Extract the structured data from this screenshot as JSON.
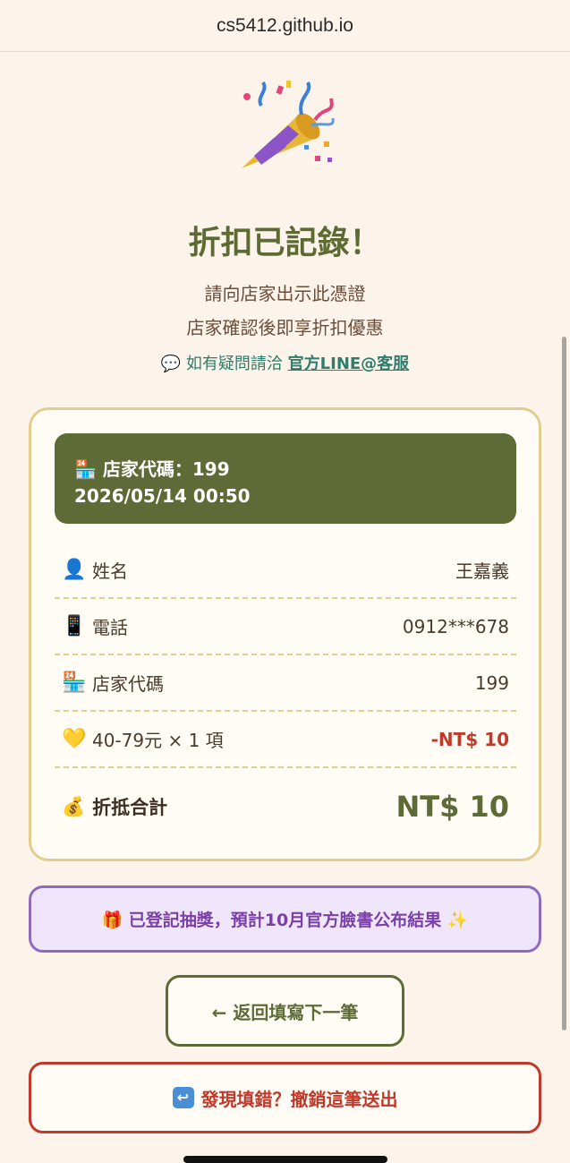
{
  "browser": {
    "url": "cs5412.github.io"
  },
  "header": {
    "icon": "party-popper-icon",
    "title": "折扣已記錄！",
    "subtitle_1": "請向店家出示此憑證",
    "subtitle_2": "店家確認後即享折扣優惠",
    "help_prefix": "💬 如有疑問請洽 ",
    "help_link": "官方LINE@客服"
  },
  "card": {
    "banner": {
      "icon": "convenience-store-icon",
      "store_code_line": "🏪 店家代碼：199",
      "datetime": "2026/05/14 00:50"
    },
    "rows": [
      {
        "icon": "👤",
        "label": "姓名",
        "value": "王嘉義"
      },
      {
        "icon": "📱",
        "label": "電話",
        "value": "0912***678"
      },
      {
        "icon": "🏪",
        "label": "店家代碼",
        "value": "199"
      },
      {
        "icon": "💛",
        "label": "40-79元 × 1 項",
        "value": "-NT$ 10"
      }
    ],
    "total": {
      "icon": "💰",
      "label": "折抵合計",
      "amount": "NT$ 10"
    }
  },
  "lottery": {
    "text": "🎁 已登記抽獎，預計10月官方臉書公布結果 ✨"
  },
  "buttons": {
    "back": "← 返回填寫下一筆",
    "undo_icon": "↩",
    "undo": "發現填錯？撤銷這筆送出"
  },
  "colors": {
    "background": "#fcf4ea",
    "accent_green": "#5e6b36",
    "card_border": "#e3cd8e",
    "danger": "#c0392b",
    "lottery_purple": "#8e6bbd",
    "link_teal": "#2e7d6b"
  }
}
